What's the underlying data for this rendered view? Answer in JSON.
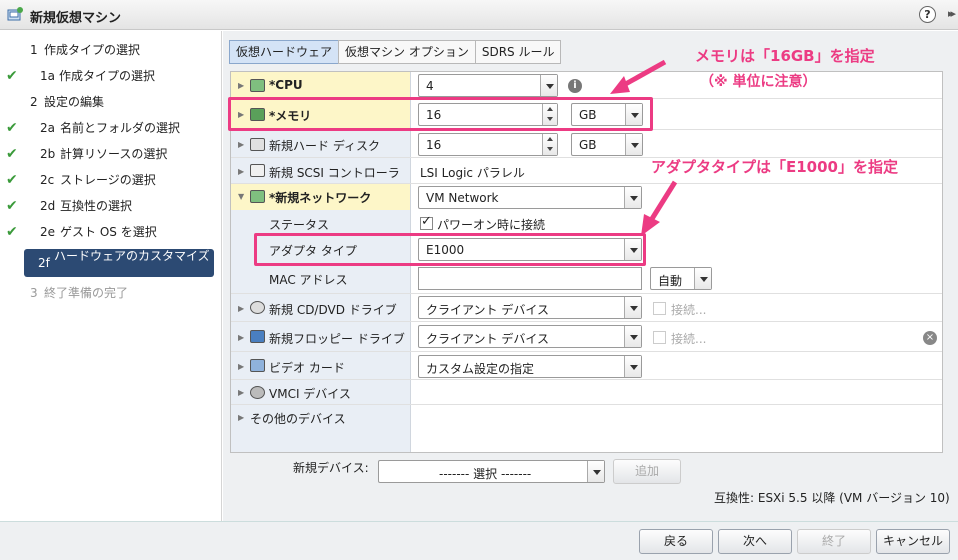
{
  "window": {
    "title": "新規仮想マシン",
    "help": "?",
    "expand": "▸▸"
  },
  "steps": [
    {
      "num": "1",
      "label": "作成タイプの選択",
      "checked": false
    },
    {
      "num": "1a",
      "label": "作成タイプの選択",
      "checked": true
    },
    {
      "num": "2",
      "label": "設定の編集",
      "checked": false
    },
    {
      "num": "2a",
      "label": "名前とフォルダの選択",
      "checked": true
    },
    {
      "num": "2b",
      "label": "計算リソースの選択",
      "checked": true
    },
    {
      "num": "2c",
      "label": "ストレージの選択",
      "checked": true
    },
    {
      "num": "2d",
      "label": "互換性の選択",
      "checked": true
    },
    {
      "num": "2e",
      "label": "ゲスト OS を選択",
      "checked": true
    },
    {
      "num": "2f",
      "label": "ハードウェアのカスタマイズ",
      "checked": false,
      "active": true
    },
    {
      "num": "3",
      "label": "終了準備の完了",
      "checked": false,
      "disabled": true
    }
  ],
  "check_glyph": "✔",
  "tabs": [
    "仮想ハードウェア",
    "仮想マシン オプション",
    "SDRS ルール"
  ],
  "hardware": {
    "cpu": {
      "name": "*CPU",
      "value": "4"
    },
    "memory": {
      "name": "*メモリ",
      "value": "16",
      "unit": "GB"
    },
    "disk": {
      "name": "新規ハード ディスク",
      "value": "16",
      "unit": "GB"
    },
    "scsi": {
      "name": "新規 SCSI コントローラ",
      "value": "LSI Logic パラレル"
    },
    "network": {
      "name": "*新規ネットワーク",
      "value": "VM Network",
      "status_label": "ステータス",
      "status_value": "パワーオン時に接続",
      "adapter_label": "アダプタ タイプ",
      "adapter_value": "E1000",
      "mac_label": "MAC アドレス",
      "mac_mode": "自動"
    },
    "cddvd": {
      "name": "新規 CD/DVD ドライブ",
      "value": "クライアント デバイス",
      "connect": "接続..."
    },
    "floppy": {
      "name": "新規フロッピー ドライブ",
      "value": "クライアント デバイス",
      "connect": "接続..."
    },
    "video": {
      "name": "ビデオ カード",
      "value": "カスタム設定の指定"
    },
    "vmci": {
      "name": "VMCI デバイス"
    },
    "other": {
      "name": "その他のデバイス"
    }
  },
  "new_device": {
    "label": "新規デバイス:",
    "placeholder": "------- 選択 -------",
    "add": "追加"
  },
  "compat": "互換性: ESXi 5.5 以降 (VM バージョン 10)",
  "buttons": {
    "back": "戻る",
    "next": "次へ",
    "finish": "終了",
    "cancel": "キャンセル"
  },
  "annotations": {
    "memory_note": "メモリは「16GB」を指定",
    "memory_sub": "（※ 単位に注意）",
    "adapter_note": "アダプタタイプは「E1000」を指定"
  },
  "colors": {
    "accent": "#ec3b83",
    "active_step": "#2c4a73",
    "highlight_row": "#fdf6c8"
  }
}
